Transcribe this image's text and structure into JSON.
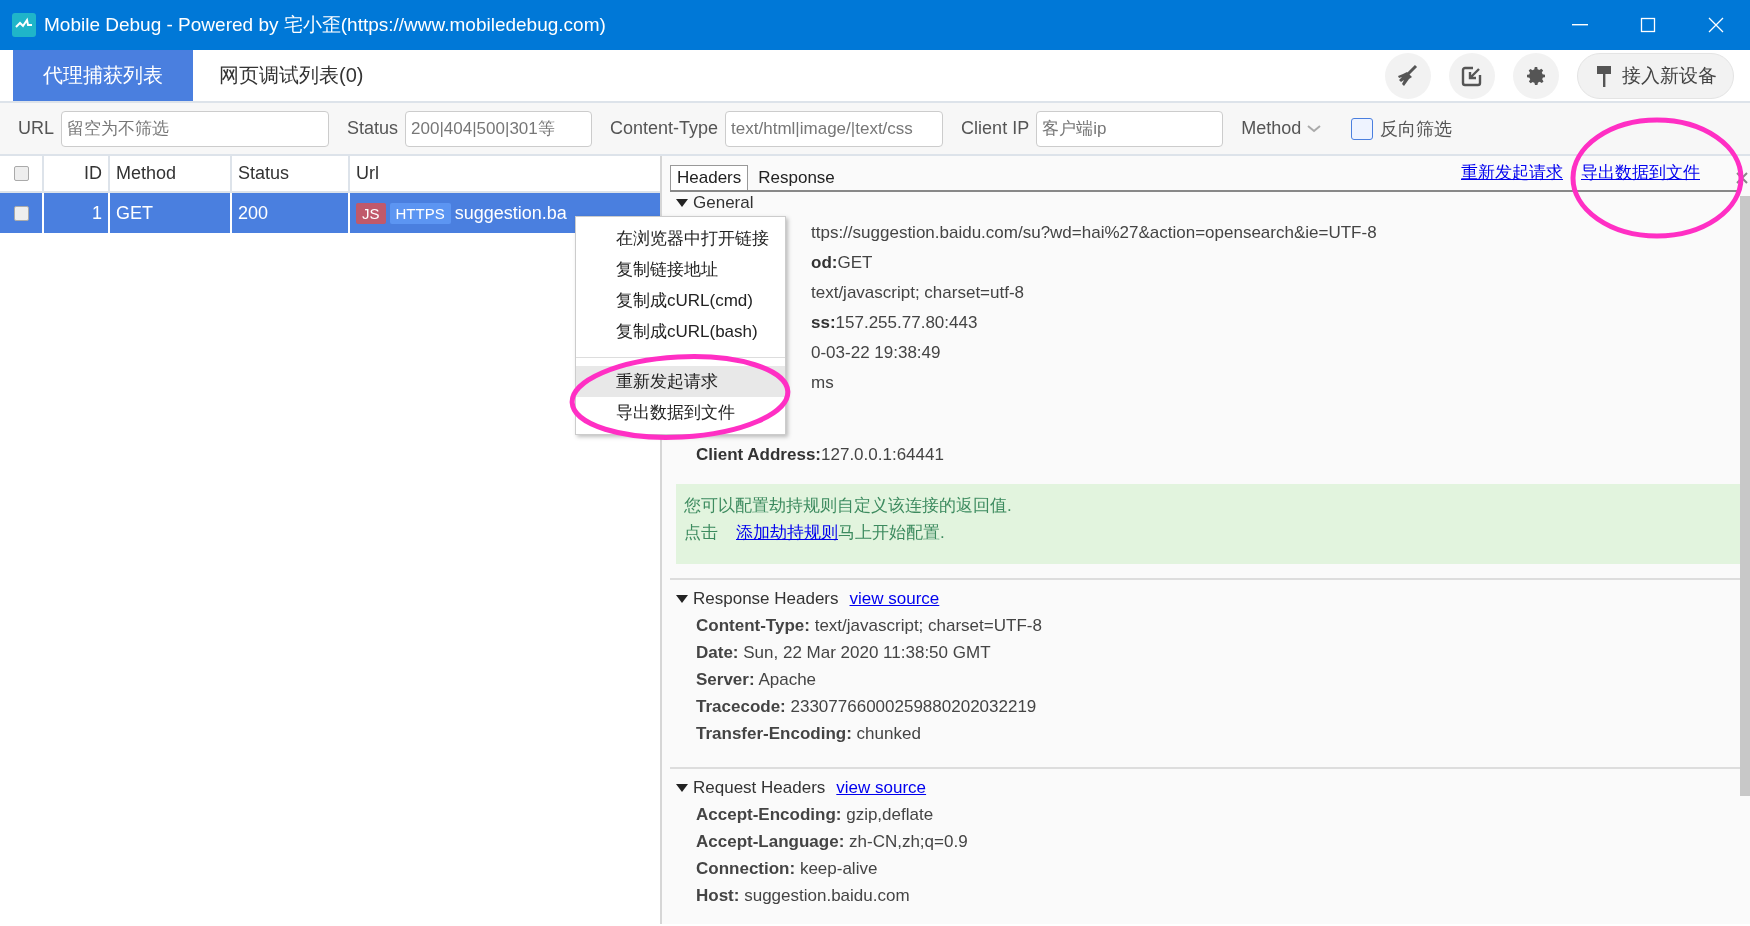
{
  "window": {
    "title": "Mobile Debug - Powered by 宅小歪(https://www.mobiledebug.com)"
  },
  "tabs": [
    {
      "label": "代理捕获列表",
      "selected": true
    },
    {
      "label": "网页调试列表(0)",
      "selected": false
    }
  ],
  "toolbar": {
    "connect_button": "接入新设备"
  },
  "filters": [
    {
      "kind": "text",
      "label": "URL",
      "placeholder": "留空为不筛选"
    },
    {
      "kind": "text",
      "label": "Status",
      "placeholder": "200|404|500|301等"
    },
    {
      "kind": "text",
      "label": "Content-Type",
      "placeholder": "text/html|image/|text/css"
    },
    {
      "kind": "text",
      "label": "Client IP",
      "placeholder": "客户端ip"
    },
    {
      "kind": "dropdown",
      "label": "Method"
    },
    {
      "kind": "checkbox",
      "label": "反向筛选",
      "checked": false
    }
  ],
  "table": {
    "columns": [
      "ID",
      "Method",
      "Status",
      "Url"
    ],
    "all_checked": false,
    "rows": [
      {
        "checked": false,
        "selected": true,
        "id": "1",
        "method": "GET",
        "status": "200",
        "tags": [
          {
            "label": "JS",
            "color": "#c0596b"
          },
          {
            "label": "HTTPS",
            "color": "#5c95f2"
          }
        ],
        "url": "suggestion.ba"
      }
    ]
  },
  "detail": {
    "tabs": [
      {
        "label": "Headers",
        "selected": true
      },
      {
        "label": "Response",
        "selected": false
      }
    ],
    "links": [
      "重新发起请求",
      "导出数据到文件"
    ],
    "general": {
      "title": "General",
      "expanded": true,
      "rows": [
        {
          "kind": "cut",
          "text": "ttps://suggestion.baidu.com/su?wd=hai%27&action=opensearch&ie=UTF-8"
        },
        {
          "kind": "cut",
          "text": "**od:**GET"
        },
        {
          "kind": "cut",
          "text": "text/javascript; charset=utf-8"
        },
        {
          "kind": "cut",
          "text": "**ss:**157.255.77.80:443"
        },
        {
          "kind": "cut",
          "text": "0-03-22 19:38:49"
        },
        {
          "kind": "cut",
          "text": "ms"
        },
        {
          "kind": "full",
          "text": "**Client Address:**127.0.0.1:64441"
        }
      ]
    },
    "notice": {
      "text": "您可以配置劫持规则自定义该连接的返回值.",
      "prefix": "点击",
      "link": "添加劫持规则",
      "suffix": "马上开始配置."
    },
    "sections": [
      {
        "title": "Response Headers",
        "link": "view source",
        "expanded": true,
        "rows": [
          {
            "name": "Content-Type:",
            "value": "text/javascript; charset=UTF-8"
          },
          {
            "name": "Date:",
            "value": "Sun, 22 Mar 2020 11:38:50 GMT"
          },
          {
            "name": "Server:",
            "value": "Apache"
          },
          {
            "name": "Tracecode:",
            "value": "23307766000259880202032219"
          },
          {
            "name": "Transfer-Encoding:",
            "value": "chunked"
          }
        ]
      },
      {
        "title": "Request Headers",
        "link": "view source",
        "expanded": true,
        "rows": [
          {
            "name": "Accept-Encoding:",
            "value": "gzip,deflate"
          },
          {
            "name": "Accept-Language:",
            "value": "zh-CN,zh;q=0.9"
          },
          {
            "name": "Connection:",
            "value": "keep-alive"
          },
          {
            "name": "Host:",
            "value": "suggestion.baidu.com"
          }
        ]
      }
    ]
  },
  "context_menu": {
    "items": [
      {
        "label": "在浏览器中打开链接",
        "selected": false,
        "separator_before": false
      },
      {
        "label": "复制链接地址",
        "selected": false,
        "separator_before": false
      },
      {
        "label": "复制成cURL(cmd)",
        "selected": false,
        "separator_before": false
      },
      {
        "label": "复制成cURL(bash)",
        "selected": false,
        "separator_before": false
      },
      {
        "label": "重新发起请求",
        "selected": true,
        "separator_before": true
      },
      {
        "label": "导出数据到文件",
        "selected": false,
        "separator_before": false
      }
    ]
  },
  "annotations": [
    {
      "kind": "ellipse",
      "color": "#ff2fc4"
    },
    {
      "kind": "ellipse",
      "color": "#ff2fc4"
    }
  ]
}
